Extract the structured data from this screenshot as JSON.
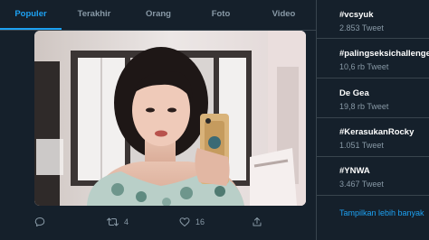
{
  "tabs": [
    {
      "label": "Populer",
      "active": true
    },
    {
      "label": "Terakhir",
      "active": false
    },
    {
      "label": "Orang",
      "active": false
    },
    {
      "label": "Foto",
      "active": false
    },
    {
      "label": "Video",
      "active": false
    }
  ],
  "tweet": {
    "reply_count": "",
    "retweet_count": "4",
    "like_count": "16",
    "icons": [
      "reply-icon",
      "retweet-icon",
      "like-icon",
      "share-icon"
    ]
  },
  "trends": [
    {
      "name": "#vcsyuk",
      "count": "2.853 Tweet"
    },
    {
      "name": "#palingseksichallenge",
      "count": "10,6 rb Tweet"
    },
    {
      "name": "De Gea",
      "count": "19,8 rb Tweet"
    },
    {
      "name": "#KerasukanRocky",
      "count": "1.051 Tweet"
    },
    {
      "name": "#YNWA",
      "count": "3.467 Tweet"
    }
  ],
  "show_more": "Tampilkan lebih banyak",
  "colors": {
    "background": "#15202b",
    "accent": "#1da1f2",
    "muted_text": "#8899a6",
    "divider": "#38444d"
  }
}
